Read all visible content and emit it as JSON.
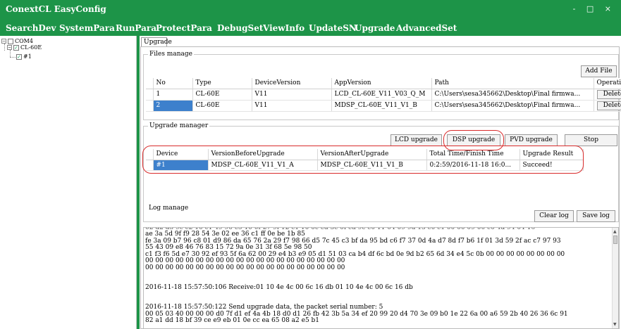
{
  "window": {
    "title": "ConextCL EasyConfig",
    "controls": [
      "-",
      "□",
      "×"
    ]
  },
  "menu": [
    "SearchDev",
    "SystemPara",
    "RunPara",
    "ProtectPara",
    "DebugSet",
    "ViewInfo",
    "UpdateSN",
    "Upgrade",
    "AdvancedSet"
  ],
  "tree": {
    "port": "COM4",
    "device": "CL-60E",
    "unit": "#1"
  },
  "tab_label": "Upgrade",
  "files": {
    "label": "Files manage",
    "add_label": "Add File",
    "columns": [
      "No",
      "Type",
      "DeviceVersion",
      "AppVersion",
      "Path",
      "Operating"
    ],
    "rows": [
      {
        "no": "1",
        "type": "CL-60E",
        "device_version": "V11",
        "app_version": "LCD_CL-60E_V11_V03_Q_M",
        "path": "C:\\Users\\sesa345662\\Desktop\\Final firmwa...",
        "op": "Delete"
      },
      {
        "no": "2",
        "type": "CL-60E",
        "device_version": "V11",
        "app_version": "MDSP_CL-60E_V11_V1_B",
        "path": "C:\\Users\\sesa345662\\Desktop\\Final firmwa...",
        "op": "Delete"
      }
    ]
  },
  "upgrade": {
    "label": "Upgrade manager",
    "buttons": {
      "lcd": "LCD upgrade",
      "dsp": "DSP upgrade",
      "pvd": "PVD upgrade",
      "stop": "Stop"
    },
    "columns": [
      "Device",
      "VersionBeforeUpgrade",
      "VersionAfterUpgrade",
      "Total Time/Finish Time",
      "Upgrade Result"
    ],
    "rows": [
      {
        "device": "#1",
        "before": "MDSP_CL-60E_V11_V1_A",
        "after": "MDSP_CL-60E_V11_V1_B",
        "time": "0:2:59/2016-11-18 16:0...",
        "result": "Succeed!"
      }
    ]
  },
  "log": {
    "label": "Log manage",
    "clear_label": "Clear log",
    "save_label": "Save log",
    "lines": [
      "ae 3a 5d 9f f9 28 54 3e 02 ee 36 c1 ff 0e be 1b 85",
      "fe 3a 09 b7 96 c8 01 d9 86 da 65 76 2a 29 f7 98 66 d5 7c 45 c3 bf da 95 bd c6 f7 37 0d 4a d7 8d f7 b6 1f 01 3d 59 2f ac c7 97 93",
      "55 43 09 e8 46 76 83 15 72 9a 0e 31 3f 68 5e 98 50",
      "c1 f3 f6 5d e7 30 92 ef 93 5f 6a 62 00 29 e4 b3 e9 05 d1 51 03 ca b4 df 6c bd 0e 9d b2 65 6d 34 e4 5c 0b 00 00 00 00 00 00 00 00",
      "00 00 00 00 00 00 00 00 00 00 00 00 00 00 00 00 00 00 00 00",
      "00 00 00 00 00 00 00 00 00 00 00 00 00 00 00 00 00 00 00 00",
      "2016-11-18 15:57:50:106 Receive:01 10 4e 4c 00 6c 16 db 01 10 4e 4c 00 6c 16 db",
      "2016-11-18 15:57:50:122 Send upgrade data, the packet serial number: 5",
      "00 05 03 40 00 00 00 d0 7f d1 ef 4a 4b 18 d0 d1 26 fb 42 3b 5a 34 ef 20 99 20 d4 70 3e 09 b0 1e 22 6a 00 a6 59 2b 40 26 36 6c 91",
      "82 a1 dd 18 bf 39 ce e9 eb 01 0e cc ea 65 08 a2 e5 b1"
    ]
  },
  "colors": {
    "accent": "#1d9448",
    "selection": "#3d80cc",
    "annotation": "#d92b2b"
  }
}
